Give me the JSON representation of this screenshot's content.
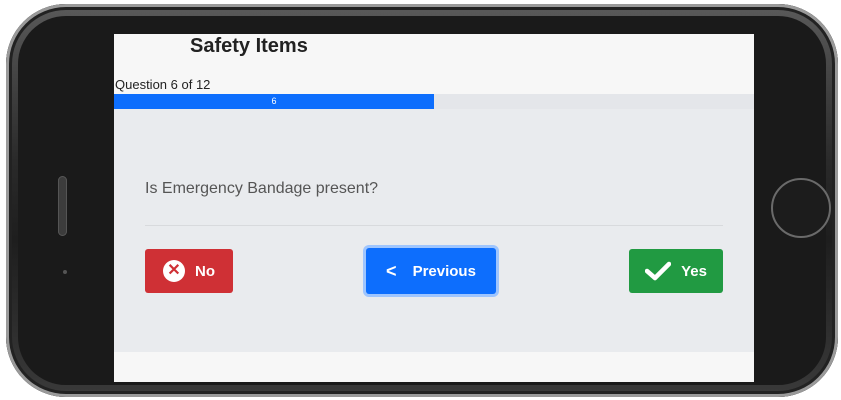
{
  "header": {
    "title": "Safety Items"
  },
  "progress": {
    "counter_text": "Question 6 of 12",
    "current": 6,
    "total": 12,
    "fill_label": "6",
    "fill_fraction": 0.5
  },
  "question": {
    "text": "Is Emergency Bandage present?"
  },
  "buttons": {
    "no_label": "No",
    "previous_label": "Previous",
    "yes_label": "Yes"
  },
  "icons": {
    "no": "x-circle-icon",
    "previous": "chevron-left-icon",
    "yes": "check-icon"
  },
  "colors": {
    "no": "#cf3035",
    "previous": "#0d6efd",
    "yes": "#219a42",
    "progress": "#0d6efd"
  }
}
